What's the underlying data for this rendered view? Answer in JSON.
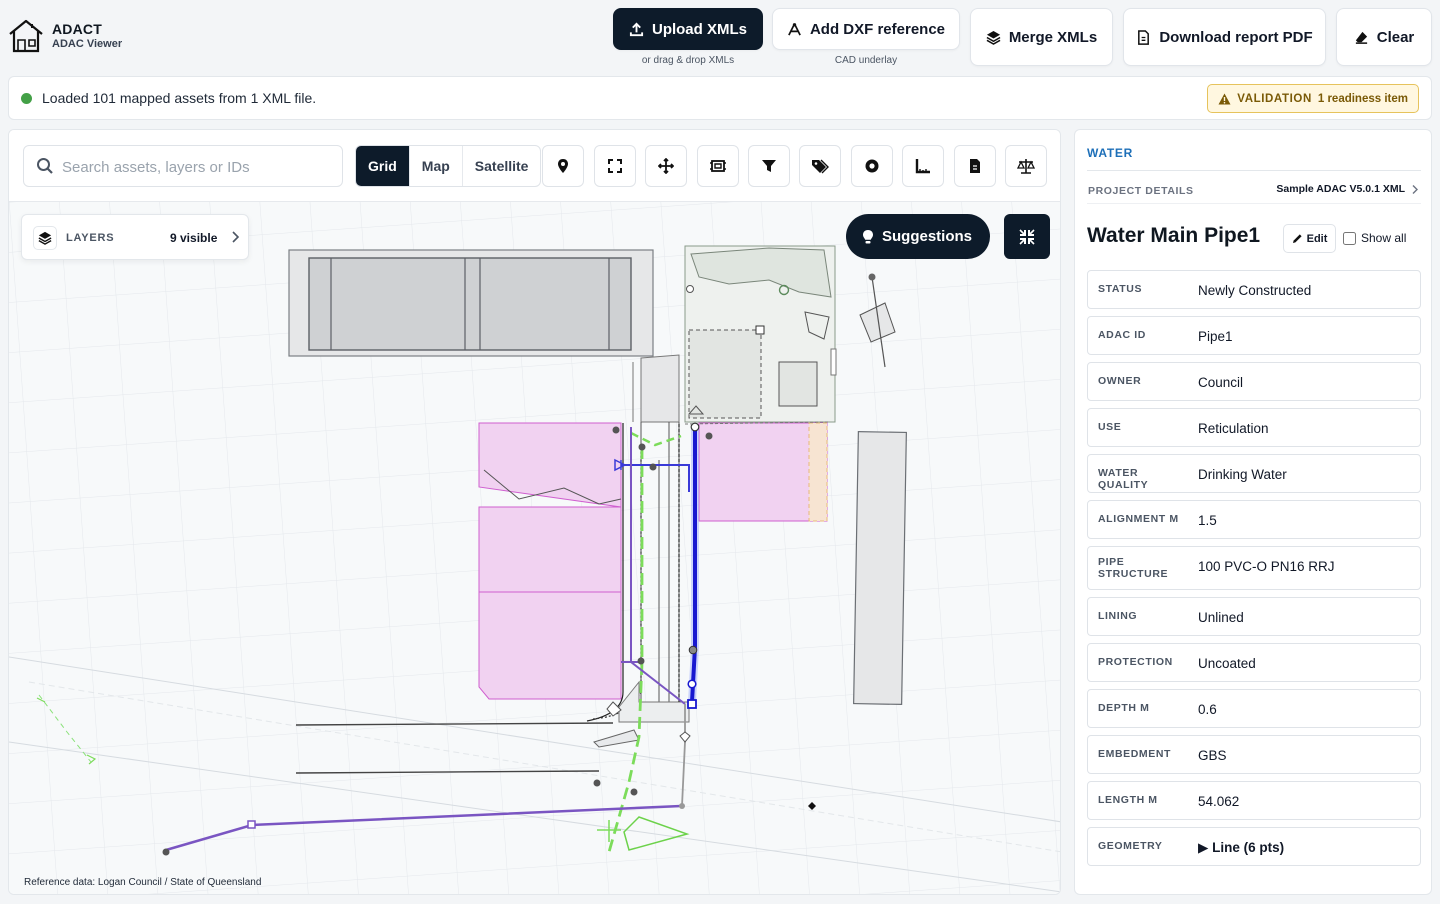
{
  "app": {
    "name": "ADACT",
    "subtitle": "ADAC Viewer"
  },
  "header": {
    "upload_label": "Upload XMLs",
    "upload_sub": "or drag & drop XMLs",
    "dxf_label": "Add DXF reference",
    "dxf_sub": "CAD underlay",
    "merge_label": "Merge XMLs",
    "download_label": "Download report PDF",
    "clear_label": "Clear"
  },
  "status": {
    "message": "Loaded 101 mapped assets from 1 XML file.",
    "validation_label": "VALIDATION",
    "validation_count": "1 readiness item",
    "dot_color": "#43a047"
  },
  "toolbar": {
    "search_placeholder": "Search assets, layers or IDs",
    "basemaps": [
      "Grid",
      "Map",
      "Satellite"
    ],
    "active_basemap": "Grid",
    "tools": [
      "location-pin-icon",
      "fit-extent-icon",
      "pan-icon",
      "frame-icon",
      "filter-icon",
      "tags-icon",
      "point-icon",
      "measure-icon",
      "document-icon",
      "compare-icon"
    ]
  },
  "map": {
    "layers_label": "LAYERS",
    "layers_count": "9 visible",
    "suggestions_label": "Suggestions",
    "reference_data": "Reference data: Logan Council / State of Queensland"
  },
  "detail": {
    "category": "WATER",
    "project_details_label": "PROJECT DETAILS",
    "project_name": "Sample ADAC V5.0.1 XML",
    "title": "Water Main Pipe1",
    "edit_label": "Edit",
    "show_all_label": "Show all",
    "properties": [
      {
        "key": "STATUS",
        "value": "Newly Constructed"
      },
      {
        "key": "ADAC ID",
        "value": "Pipe1"
      },
      {
        "key": "OWNER",
        "value": "Council"
      },
      {
        "key": "USE",
        "value": "Reticulation"
      },
      {
        "key": "WATER QUALITY",
        "value": "Drinking Water"
      },
      {
        "key": "ALIGNMENT M",
        "value": "1.5"
      },
      {
        "key": "PIPE STRUCTURE",
        "value": "100 PVC-O PN16 RRJ"
      },
      {
        "key": "LINING",
        "value": "Unlined"
      },
      {
        "key": "PROTECTION",
        "value": "Uncoated"
      },
      {
        "key": "DEPTH M",
        "value": "0.6"
      },
      {
        "key": "EMBEDMENT",
        "value": "GBS"
      },
      {
        "key": "LENGTH M",
        "value": "54.062"
      },
      {
        "key": "GEOMETRY",
        "value": "▶ Line (6 pts)"
      }
    ]
  }
}
